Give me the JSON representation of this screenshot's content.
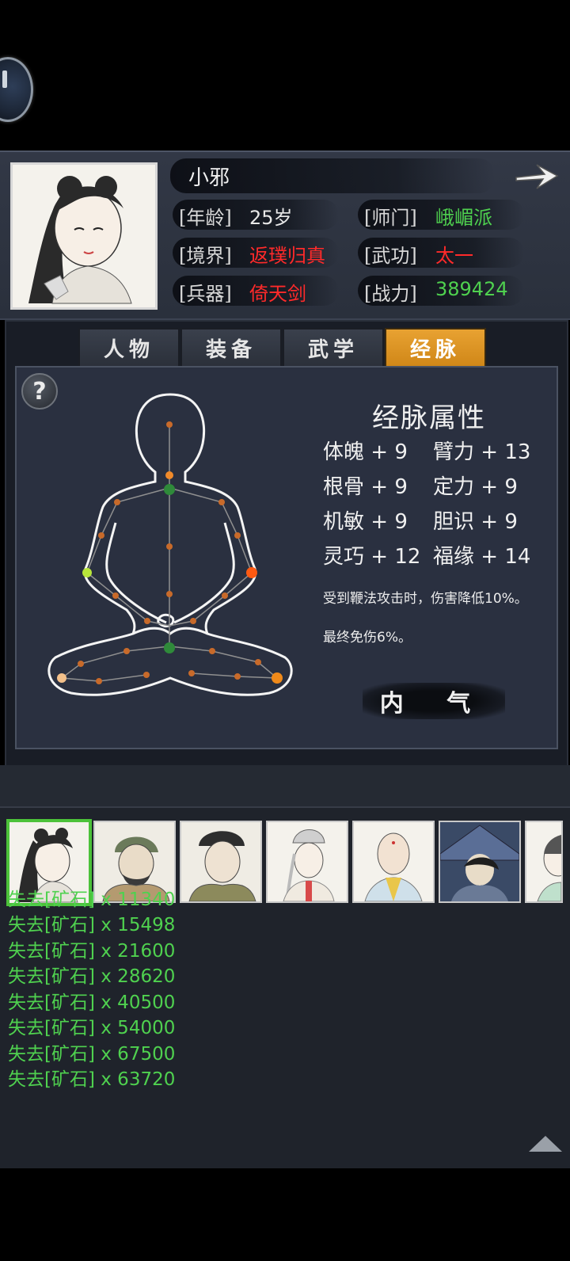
{
  "character": {
    "name": "小邪",
    "fields": [
      {
        "label": "[年龄]",
        "value": "25岁"
      },
      {
        "label": "[师门]",
        "value": "峨嵋派"
      },
      {
        "label": "[境界]",
        "value": "返璞归真"
      },
      {
        "label": "[武功]",
        "value": "太一"
      },
      {
        "label": "[兵器]",
        "value": "倚天剑"
      },
      {
        "label": "[战力]",
        "value": "389424"
      }
    ]
  },
  "tabs": [
    "人物",
    "装备",
    "武学",
    "经脉"
  ],
  "active_tab": "经脉",
  "meridian": {
    "title": "经脉属性",
    "stats": [
      {
        "name": "体魄",
        "bonus": "+ 9"
      },
      {
        "name": "臂力",
        "bonus": "+ 13"
      },
      {
        "name": "根骨",
        "bonus": "+ 9"
      },
      {
        "name": "定力",
        "bonus": "+ 9"
      },
      {
        "name": "机敏",
        "bonus": "+ 9"
      },
      {
        "name": "胆识",
        "bonus": "+ 9"
      },
      {
        "name": "灵巧",
        "bonus": "+ 12"
      },
      {
        "name": "福缘",
        "bonus": "+ 14"
      }
    ],
    "effects": [
      "受到鞭法攻击时，伤害降低10%。",
      "最终免伤6%。"
    ],
    "inner_qi_label": "内 气"
  },
  "log": [
    "失去[矿石] x 11340",
    "失去[矿石] x 15498",
    "失去[矿石] x 21600",
    "失去[矿石] x 28620",
    "失去[矿石] x 40500",
    "失去[矿石] x 54000",
    "失去[矿石] x 67500",
    "失去[矿石] x 63720"
  ],
  "colors": {
    "accent_tab": "#e8a232",
    "green": "#4fd14f",
    "red": "#ff2a2a"
  },
  "icons": [
    "back-icon",
    "arrow-right-icon",
    "question-mark-icon",
    "triangle-up-icon"
  ]
}
